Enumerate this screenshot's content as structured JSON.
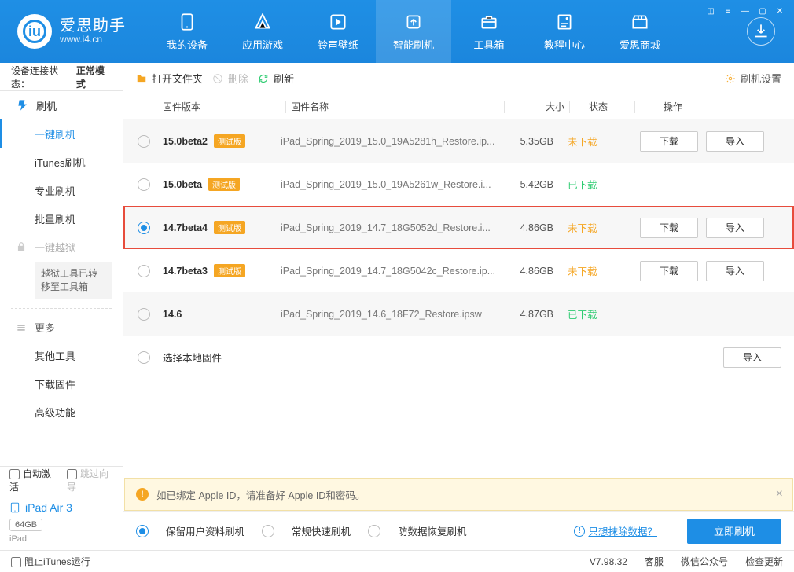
{
  "brand": {
    "name": "爱思助手",
    "url": "www.i4.cn"
  },
  "nav": {
    "items": [
      {
        "label": "我的设备"
      },
      {
        "label": "应用游戏"
      },
      {
        "label": "铃声壁纸"
      },
      {
        "label": "智能刷机"
      },
      {
        "label": "工具箱"
      },
      {
        "label": "教程中心"
      },
      {
        "label": "爱思商城"
      }
    ]
  },
  "connection": {
    "label": "设备连接状态：",
    "value": "正常模式"
  },
  "sidebar": {
    "head1": "刷机",
    "items1": [
      "一键刷机",
      "iTunes刷机",
      "专业刷机",
      "批量刷机"
    ],
    "jailbreak": "一键越狱",
    "jail_note": "越狱工具已转移至工具箱",
    "head2": "更多",
    "items2": [
      "其他工具",
      "下载固件",
      "高级功能"
    ]
  },
  "checks": {
    "auto": "自动激活",
    "skip": "跳过向导",
    "blockitunes": "阻止iTunes运行"
  },
  "device": {
    "name": "iPad Air 3",
    "storage": "64GB",
    "model": "iPad"
  },
  "toolbar": {
    "open": "打开文件夹",
    "delete": "删除",
    "refresh": "刷新",
    "settings": "刷机设置"
  },
  "columns": {
    "version": "固件版本",
    "name": "固件名称",
    "size": "大小",
    "status": "状态",
    "ops": "操作"
  },
  "badge": "测试版",
  "btn": {
    "dl": "下载",
    "imp": "导入"
  },
  "rows": [
    {
      "version": "15.0beta2",
      "beta": true,
      "name": "iPad_Spring_2019_15.0_19A5281h_Restore.ip...",
      "size": "5.35GB",
      "status": "未下载",
      "dl": true,
      "imp": true,
      "downloaded": false,
      "selected": false
    },
    {
      "version": "15.0beta",
      "beta": true,
      "name": "iPad_Spring_2019_15.0_19A5261w_Restore.i...",
      "size": "5.42GB",
      "status": "已下载",
      "dl": false,
      "imp": false,
      "downloaded": true,
      "selected": false
    },
    {
      "version": "14.7beta4",
      "beta": true,
      "name": "iPad_Spring_2019_14.7_18G5052d_Restore.i...",
      "size": "4.86GB",
      "status": "未下载",
      "dl": true,
      "imp": true,
      "downloaded": false,
      "selected": true
    },
    {
      "version": "14.7beta3",
      "beta": true,
      "name": "iPad_Spring_2019_14.7_18G5042c_Restore.ip...",
      "size": "4.86GB",
      "status": "未下载",
      "dl": true,
      "imp": true,
      "downloaded": false,
      "selected": false
    },
    {
      "version": "14.6",
      "beta": false,
      "name": "iPad_Spring_2019_14.6_18F72_Restore.ipsw",
      "size": "4.87GB",
      "status": "已下载",
      "dl": false,
      "imp": false,
      "downloaded": true,
      "selected": false
    }
  ],
  "local_row": "选择本地固件",
  "notice": "如已绑定 Apple ID，请准备好 Apple ID和密码。",
  "flash_opts": {
    "keep": "保留用户资料刷机",
    "normal": "常规快速刷机",
    "anti": "防数据恢复刷机"
  },
  "wipe_link": "只想抹除数据？",
  "flash_btn": "立即刷机",
  "status": {
    "version": "V7.98.32",
    "service": "客服",
    "wechat": "微信公众号",
    "update": "检查更新"
  }
}
